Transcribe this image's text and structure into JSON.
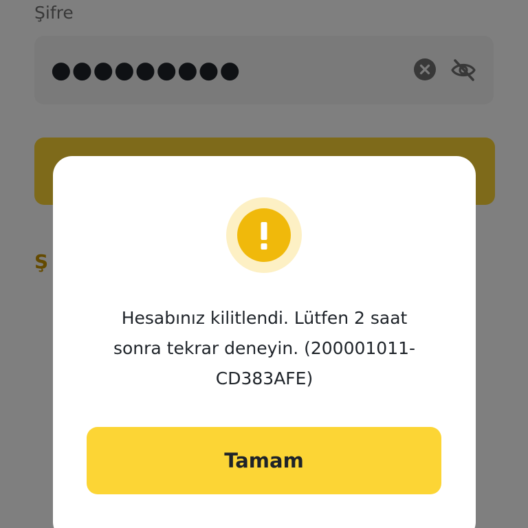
{
  "form": {
    "password_label": "Şifre",
    "password_value": "●●●●●●●●●",
    "forgot_link_visible": "Ş"
  },
  "icons": {
    "clear": "clear-circle-x-icon",
    "visibility": "eye-off-icon",
    "warning": "exclamation-icon"
  },
  "dialog": {
    "message_lines": [
      "Hesabınız kilitlendi. Lütfen 2 saat",
      "sonra tekrar deneyin. (200001011-",
      "CD383AFE)"
    ],
    "ok_label": "Tamam"
  },
  "colors": {
    "accent": "#fcd535",
    "warning": "#f0b90b",
    "warning_halo": "#fdf0c4",
    "text_primary": "#1e2329",
    "link": "#c99400"
  }
}
